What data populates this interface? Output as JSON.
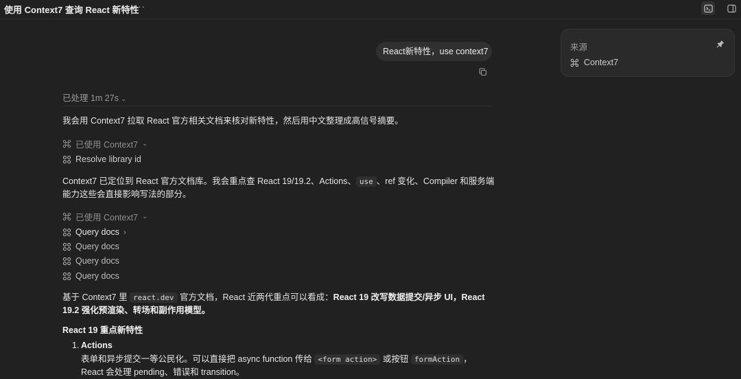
{
  "header": {
    "title": "使用 Context7 查询 React 新特性",
    "more_label": "···"
  },
  "user_message": "React新特性，use context7",
  "processed": {
    "label": "已处理 1m 27s"
  },
  "intro": "我会用 Context7 拉取 React 官方相关文档来核对新特性，然后用中文整理成高信号摘要。",
  "tool_group_1": {
    "used_label": "已使用 Context7",
    "items": [
      "Resolve library id"
    ]
  },
  "para2": {
    "a": "Context7 已定位到 React 官方文档库。我会重点查 React 19/19.2、Actions、",
    "code": "use",
    "b": "、ref 变化、Compiler 和服务端能力这些会直接影响写法的部分。"
  },
  "tool_group_2": {
    "used_label": "已使用 Context7",
    "items": [
      "Query docs",
      "Query docs",
      "Query docs",
      "Query docs"
    ]
  },
  "para3": {
    "a": "基于 Context7 里 ",
    "code": "react.dev",
    "b": " 官方文档，React 近两代重点可以看成：",
    "bold": "React 19 改写数据提交/异步 UI，React 19.2 强化预渲染、转场和副作用模型。"
  },
  "section_heading": "React 19 重点新特性",
  "list": {
    "num": "1.",
    "title": "Actions",
    "a": "表单和异步提交一等公民化。可以直接把 async function 传给 ",
    "code1": "<form action>",
    "b": " 或按钮 ",
    "code2": "formAction",
    "c": "，React 会处理 pending、错误和 transition。"
  },
  "sources": {
    "title": "来源",
    "items": [
      "Context7"
    ]
  },
  "icons": {
    "tool": "command-icon",
    "item": "grid-icon",
    "copy": "copy-icon",
    "pin": "pin-icon",
    "terminal": "terminal-icon",
    "panel": "sidebar-panel-icon"
  },
  "colors": {
    "background": "#212121",
    "bubble": "#303030",
    "card": "#2a2a2a",
    "muted_text": "#9a9a9a"
  }
}
